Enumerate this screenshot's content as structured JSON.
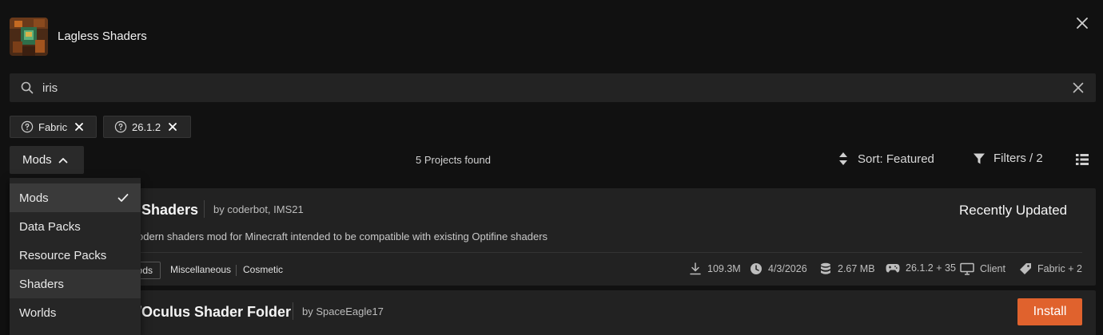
{
  "header": {
    "title": "Lagless Shaders",
    "close_icon": "close-icon"
  },
  "search": {
    "value": "iris",
    "placeholder": "Search"
  },
  "chips": [
    {
      "label": "Fabric"
    },
    {
      "label": "26.1.2"
    }
  ],
  "toolbar": {
    "type_label": "Mods",
    "projects_found": "5 Projects found",
    "sort_label": "Sort: Featured",
    "filters_label": "Filters / 2"
  },
  "dropdown": {
    "items": [
      {
        "label": "Mods",
        "selected": true
      },
      {
        "label": "Data Packs"
      },
      {
        "label": "Resource Packs"
      },
      {
        "label": "Shaders",
        "hover": true
      },
      {
        "label": "Worlds"
      }
    ]
  },
  "projects": [
    {
      "name_visible": "Shaders",
      "author": "by coderbot, IMS21",
      "description": "odern shaders mod for Minecraft intended to be compatible with existing Optifine shaders",
      "status": "Recently Updated",
      "tags": [
        "ods",
        "Miscellaneous",
        "Cosmetic"
      ],
      "stats": {
        "downloads": "109.3M",
        "updated": "4/3/2026",
        "size": "2.67 MB",
        "versions": "26.1.2 + 35",
        "environment": "Client",
        "loaders": "Fabric + 2"
      }
    },
    {
      "name_visible": "/Oculus Shader Folder",
      "author": "by SpaceEagle17",
      "action": "Install"
    }
  ],
  "colors": {
    "accent": "#e0622d",
    "background": "#111111",
    "card": "#222222"
  }
}
